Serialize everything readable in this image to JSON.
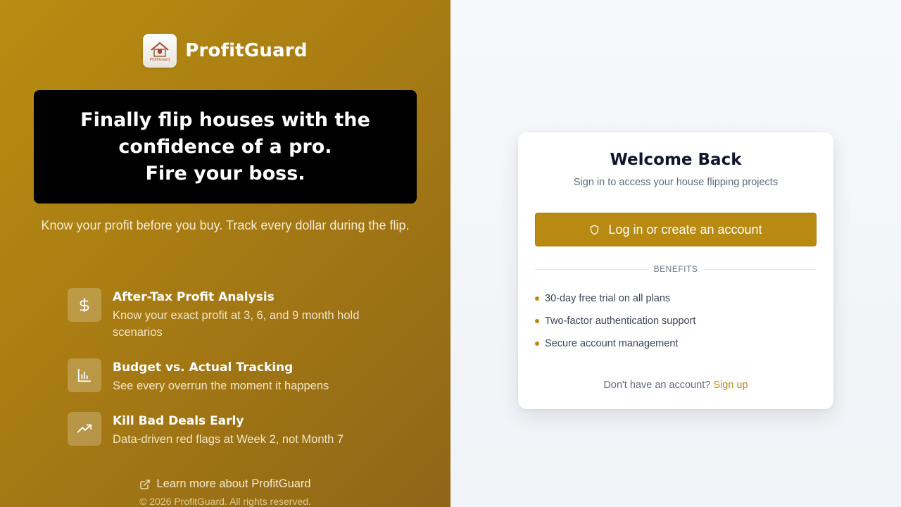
{
  "brand": {
    "name": "ProfitGuard",
    "logo_text": "ProfitGuard"
  },
  "hero": {
    "line1": "Finally flip houses with the",
    "line2": "confidence of a pro.",
    "line3": "Fire your boss."
  },
  "tagline": "Know your profit before you buy. Track every dollar during the flip.",
  "features": [
    {
      "icon": "dollar-icon",
      "title": "After-Tax Profit Analysis",
      "description": "Know your exact profit at 3, 6, and 9 month hold scenarios"
    },
    {
      "icon": "bar-chart-icon",
      "title": "Budget vs. Actual Tracking",
      "description": "See every overrun the moment it happens"
    },
    {
      "icon": "trending-up-icon",
      "title": "Kill Bad Deals Early",
      "description": "Data-driven red flags at Week 2, not Month 7"
    }
  ],
  "learn_more": "Learn more about ProfitGuard",
  "copyright": "© 2026 ProfitGuard. All rights reserved.",
  "login_card": {
    "title": "Welcome Back",
    "subtitle": "Sign in to access your house flipping projects",
    "button_label": "Log in or create an account",
    "benefits_label": "BENEFITS",
    "benefits": [
      "30-day free trial on all plans",
      "Two-factor authentication support",
      "Secure account management"
    ],
    "signup_prompt": "Don't have an account?",
    "signup_link": "Sign up"
  },
  "colors": {
    "accent": "#b88a12",
    "left_panel_start": "#b98d10",
    "left_panel_end": "#8f6618",
    "hero_bg": "#000000",
    "title_text": "#0f172a"
  }
}
